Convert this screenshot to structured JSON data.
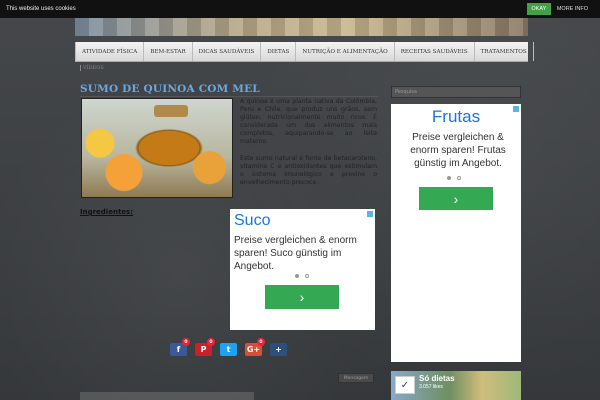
{
  "cookie_bar": {
    "message": "This website uses cookies",
    "ok_label": "OKAY",
    "more_label": "MORE INFO"
  },
  "nav": {
    "items": [
      "ATIVIDADE FÍSICA",
      "BEM-ESTAR",
      "DICAS SAUDÁVEIS",
      "DIETAS",
      "NUTRIÇÃO E ALIMENTAÇÃO",
      "RECEITAS SAUDÁVEIS",
      "TRATAMENTOS"
    ],
    "sub_item": "VÍDEOS"
  },
  "post": {
    "title": "SUMO DE QUINOA COM MEL",
    "paragraph_1": "A quinoa é uma planta nativa da Colômbia, Peru e Chile, que produz uns grãos, sem glúten, nutricionalmente muito ricos. É considerada um dos alimentos mais completos, equiparando-se ao leite materno.",
    "paragraph_2": "Este sumo natural é fonte de betacaroteno, vitamina C e antioxidantes que estimulam o sistema imunológico e previne o envelhecimento precoce.",
    "ingredients_label": "Ingredientes:"
  },
  "ad_main": {
    "title": "Suco",
    "body": "Preise vergleichen & enorm sparen! Suco günstig im Angebot.",
    "cta": "›"
  },
  "ad_sidebar": {
    "title": "Frutas",
    "body": "Preise vergleichen & enorm sparen! Frutas günstig im Angebot.",
    "cta": "›"
  },
  "social": {
    "fb_count": "0",
    "pin_count": "0",
    "gp_count": "0",
    "icons": [
      "facebook-icon",
      "pinterest-icon",
      "twitter-icon",
      "google-plus-icon",
      "share-icon"
    ]
  },
  "older_posts_label": "Mensagem",
  "search": {
    "placeholder": "Pesquisa"
  },
  "facebook_widget": {
    "title": "Só dietas",
    "likes": "3.057 likes"
  },
  "colors": {
    "title_blue": "#6aa9e0",
    "ad_green": "#34a853",
    "ad_title_blue": "#1a73e8",
    "cookie_ok_green": "#43a047"
  }
}
